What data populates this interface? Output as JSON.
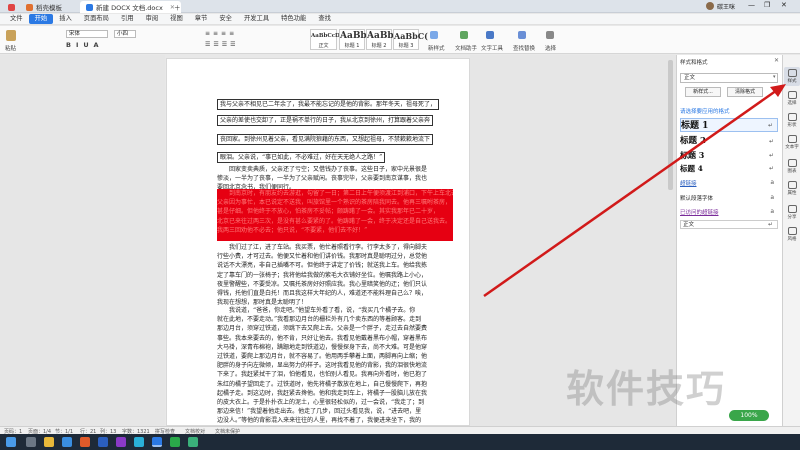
{
  "tabs": [
    {
      "label": "稻壳模板"
    },
    {
      "label": "新建 DOCX 文档.docx"
    }
  ],
  "title_user": "碳王咪",
  "menus": [
    "文件",
    "开始",
    "插入",
    "页面布局",
    "引用",
    "审阅",
    "视图",
    "章节",
    "安全",
    "开发工具",
    "特色功能",
    "查找"
  ],
  "ribbon": {
    "paste": "粘贴",
    "font": "宋体",
    "size": "小四",
    "styles": [
      {
        "preview": "AaBbCcDd",
        "label": "正文"
      },
      {
        "preview": "AaBb",
        "label": "标题 1"
      },
      {
        "preview": "AaBb(",
        "label": "标题 2"
      },
      {
        "preview": "AaBbC(",
        "label": "标题 3"
      }
    ],
    "new_style": "新样式",
    "text_tools": "文字工具",
    "doc_assist": "文档助手",
    "find_replace": "查找替换",
    "select": "选择"
  },
  "document": {
    "boxed_lines": [
      "我与父亲不相见已二年余了，我最不能忘记的是他的背影。那年冬天，祖母死了，",
      "父亲的差使也交卸了，正是祸不单行的日子，我从北京到徐州，打算跟着父亲奔",
      "丧回家。到徐州见着父亲，看见满院狼藉的东西，又想起祖母，不禁簌簌地流下",
      "眼泪。父亲说，“事已如此，不必难过，好在天无绝人之路！”"
    ],
    "para1": [
      "回家变卖典质，父亲还了亏空；又借钱办了丧事。这些日子，家中光景很是",
      "惨淡，一半为了丧事，一半为了父亲赋闲。丧事完毕，父亲要到南京谋事，我也",
      "要回北京念书，我们便同行。"
    ],
    "red_lines": [
      "到南京时，有朋友约去游逛，勾留了一日；第二日上午便须渡江到浦口，下午上车北去。",
      "父亲因为事忙，本已说定不送我，叫旅馆里一个熟识的茶房陪我同去。他再三嘱咐茶房，",
      "甚是仔细。但他终于不放心，怕茶房不妥帖；颇踌躇了一会。其实我那年已二十岁，",
      "北京已来往过两三次，是没有甚么要紧的了。他踌躇了一会，终于决定还是自己送我去。",
      "我两三回劝他不必去；他只说，“不要紧，他们去不好！”"
    ],
    "para2": [
      "我们过了江，进了车站。我买票，他忙着照看行李。行李太多了，得向脚夫",
      "行些小费，才可过去。他便又忙着和他们讲价钱。我那时真是聪明过分，总觉他",
      "说话不大漂亮，非自己插嘴不可。但他终于讲定了价钱；就送我上车。他给我拣",
      "定了靠车门的一张椅子；我将他给我做的紫毛大衣铺好坐位。他嘱我路上小心，",
      "夜里警醒些，不要受凉。又嘱托茶房好好照应我。我心里暗笑他的迂；他们只认",
      "得钱，托他们直是白托！而且我这样大年纪的人，难道还不能料理自己么？唉，",
      "我现在想想，那时真是太聪明了！"
    ],
    "para3": [
      "我说道，“爸爸，你走吧。”他望车外看了看，说，“我买几个橘子去。你",
      "就在此地，不要走动。”我看那边月台的栅栏外有几个卖东西的等着顾客。走到",
      "那边月台，须穿过铁道，须跳下去又爬上去。父亲是一个胖子，走过去自然要费",
      "事些。我本来要去的，他不肯，只好让他去。我看见他戴着黑布小帽，穿着黑布",
      "大马褂，深青布棉袍，蹒跚地走到铁道边，慢慢探身下去，尚不大难。可是他穿",
      "过铁道，要爬上那边月台，就不容易了。他用两手攀着上面，两脚再向上缩；他",
      "肥胖的身子向左微倾，显出努力的样子。这时我看见他的背影，我的泪很快地流",
      "下来了。我赶紧拭干了泪，怕他看见，也怕别人看见。我再向外看时，他已抱了",
      "朱红的橘子望回走了。过铁道时，他先将橘子散放在地上，自己慢慢爬下，再抱",
      "起橘子走。到这边时，我赶紧去搀他。他和我走到车上，将橘子一股脑儿放在我",
      "的皮大衣上。于是扑扑衣上的泥土，心里很轻松似的，过一会说，“我走了；到",
      "那边来信！”我望着他走出去。他走了几步，回过头看见我，说，“进去吧，里",
      "边没人。”等他的背影混入来来往往的人里，再找不着了，我便进来坐下，我的"
    ]
  },
  "pane": {
    "header": "样式和格式",
    "current_style": "正文",
    "new_button": "新样式...",
    "clear_button": "清除格式",
    "apply_hint": "请选择要应用的格式",
    "headings": [
      "标题 1",
      "标题 2",
      "标题 3",
      "标题 4"
    ],
    "others": [
      "超链接",
      "默认段落字体",
      "已访问的超链接"
    ],
    "bottom_style": "正文"
  },
  "right_sidebar": [
    "样式",
    "选择",
    "形状",
    "文本字",
    "图表",
    "属性",
    "分享",
    "风格"
  ],
  "status": {
    "page": "页码：1",
    "pages": "页面：1/4",
    "section": "节：1/1",
    "row": "行：21",
    "col": "列：13",
    "words": "字数：1321",
    "spell": "拼写检查",
    "docverify": "文档校对",
    "protect": "文档未保护",
    "zoom": "100%"
  },
  "watermark": "软件技巧",
  "colors": {
    "accent": "#2b79e4",
    "highlight": "#e60012",
    "arrow": "#d11a1a"
  }
}
